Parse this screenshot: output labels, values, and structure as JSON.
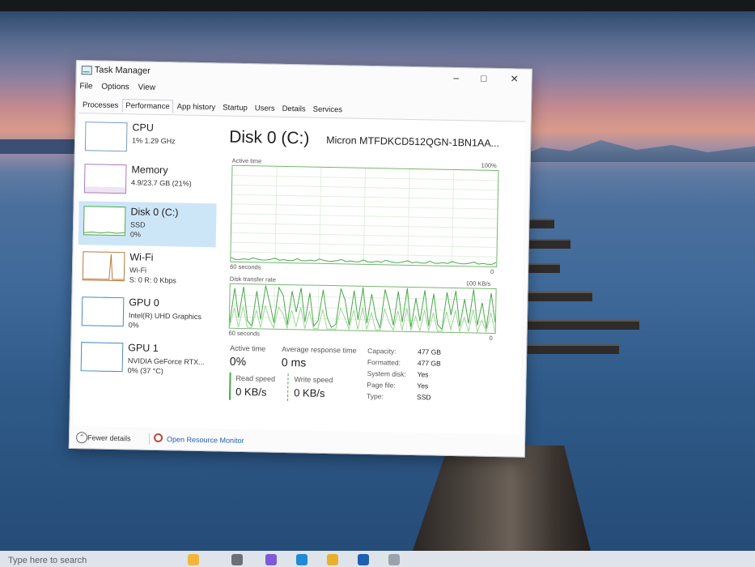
{
  "window": {
    "title": "Task Manager",
    "menu": [
      "File",
      "Options",
      "View"
    ],
    "tabs": [
      "Processes",
      "Performance",
      "App history",
      "Startup",
      "Users",
      "Details",
      "Services"
    ],
    "active_tab": "Performance"
  },
  "sidebar": {
    "items": [
      {
        "name": "CPU",
        "sub1": "1% 1.29 GHz",
        "sub2": "",
        "sub3": ""
      },
      {
        "name": "Memory",
        "sub1": "4.9/23.7 GB (21%)",
        "sub2": "",
        "sub3": ""
      },
      {
        "name": "Disk 0 (C:)",
        "sub1": "SSD",
        "sub2": "0%",
        "sub3": ""
      },
      {
        "name": "Wi-Fi",
        "sub1": "Wi-Fi",
        "sub2": "S: 0 R: 0 Kbps",
        "sub3": ""
      },
      {
        "name": "GPU 0",
        "sub1": "Intel(R) UHD Graphics",
        "sub2": "0%",
        "sub3": ""
      },
      {
        "name": "GPU 1",
        "sub1": "NVIDIA GeForce RTX...",
        "sub2": "0% (37 °C)",
        "sub3": ""
      }
    ],
    "selected": "Disk 0 (C:)"
  },
  "disk": {
    "title": "Disk 0 (C:)",
    "model": "Micron MTFDKCD512QGN-1BN1AA...",
    "active_time_graph": {
      "label": "Active time",
      "max_label": "100%",
      "left_label": "60 seconds",
      "right_label": "0"
    },
    "transfer_graph": {
      "label": "Disk transfer rate",
      "max_label": "100 KB/s",
      "left_label": "60 seconds",
      "right_label": "0"
    },
    "stats": {
      "active_time_label": "Active time",
      "active_time_value": "0%",
      "avg_response_label": "Average response time",
      "avg_response_value": "0 ms",
      "read_speed_label": "Read speed",
      "read_speed_value": "0 KB/s",
      "write_speed_label": "Write speed",
      "write_speed_value": "0 KB/s"
    },
    "properties": [
      {
        "key": "Capacity:",
        "value": "477 GB"
      },
      {
        "key": "Formatted:",
        "value": "477 GB"
      },
      {
        "key": "System disk:",
        "value": "Yes"
      },
      {
        "key": "Page file:",
        "value": "Yes"
      },
      {
        "key": "Type:",
        "value": "SSD"
      }
    ]
  },
  "footer": {
    "fewer_details": "Fewer details",
    "open_resource_monitor": "Open Resource Monitor"
  },
  "taskbar": {
    "search_placeholder": "Type here to search"
  },
  "colors": {
    "graph_green": "#4aa84a",
    "selected_bg": "#cde6f7",
    "link_blue": "#1f5fb0"
  }
}
